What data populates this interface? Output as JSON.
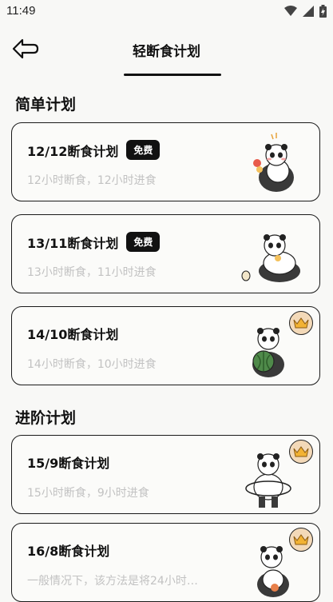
{
  "status_bar": {
    "time": "11:49"
  },
  "header": {
    "title": "轻断食计划"
  },
  "sections": [
    {
      "title": "简单计划"
    },
    {
      "title": "进阶计划"
    }
  ],
  "plans": [
    {
      "title": "12/12断食计划",
      "badge": "免费",
      "desc": "12小时断食，12小时进食",
      "locked": false
    },
    {
      "title": "13/11断食计划",
      "badge": "免费",
      "desc": "13小时断食，11小时进食",
      "locked": false
    },
    {
      "title": "14/10断食计划",
      "badge": "",
      "desc": "14小时断食，10小时进食",
      "locked": true
    },
    {
      "title": "15/9断食计划",
      "badge": "",
      "desc": "15小时断食，9小时进食",
      "locked": true
    },
    {
      "title": "16/8断食计划",
      "badge": "",
      "desc": "一般情况下，该方法是将24小时…",
      "locked": true
    }
  ],
  "colors": {
    "accent": "#111111",
    "crown_bg": "#f3d9b8",
    "muted_text": "#c2c2c2"
  },
  "icons": {
    "back": "back-arrow-icon",
    "premium": "crown-icon",
    "illustration": "panda-illustration"
  }
}
